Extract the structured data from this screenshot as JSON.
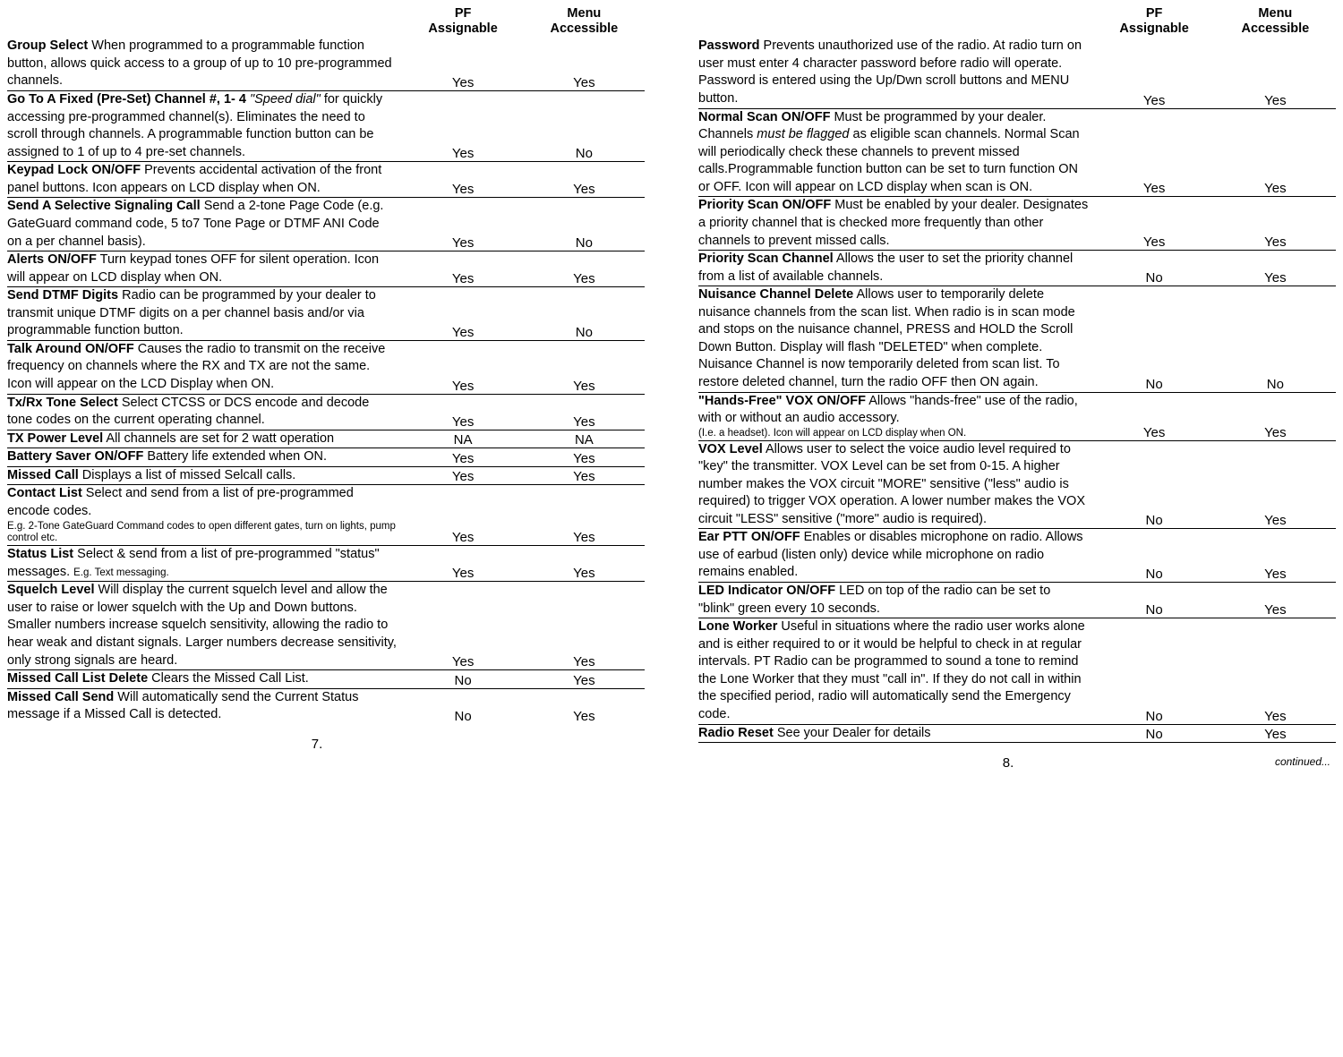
{
  "headers": {
    "pf_line1": "PF",
    "pf_line2": "Assignable",
    "menu_line1": "Menu",
    "menu_line2": "Accessible"
  },
  "pages": [
    {
      "number": "7.",
      "rows": [
        {
          "title": "Group Select",
          "text": " When programmed to a programmable function button, allows quick access to a group of up to 10 pre-programmed channels.",
          "pf": "Yes",
          "menu": "Yes"
        },
        {
          "title": "Go To A Fixed (Pre-Set) Channel #, 1- 4",
          "ital": " \"Speed dial\"",
          "text": " for quickly accessing pre-programmed channel(s). Eliminates the need to scroll through channels. A programmable function button can be assigned to 1 of up to 4 pre-set channels.",
          "pf": "Yes",
          "menu": "No"
        },
        {
          "title": "Keypad Lock ON/OFF",
          "text": " Prevents accidental activation of the front panel buttons. Icon appears on LCD display when ON.",
          "pf": "Yes",
          "menu": "Yes"
        },
        {
          "title": "Send A Selective Signaling Call",
          "text": " Send a 2-tone Page Code (e.g. GateGuard command code, 5 to7 Tone Page or DTMF ANI Code on a per channel basis).",
          "pf": "Yes",
          "menu": "No"
        },
        {
          "title": "Alerts ON/OFF",
          "text": " Turn keypad tones OFF for silent operation. Icon will appear on LCD display when ON.",
          "pf": "Yes",
          "menu": "Yes"
        },
        {
          "title": "Send DTMF Digits",
          "text": " Radio can be programmed by your dealer to transmit unique DTMF digits on a per channel basis and/or via programmable function button.",
          "pf": "Yes",
          "menu": "No"
        },
        {
          "title": "Talk Around ON/OFF",
          "text": " Causes the radio to transmit on the receive frequency on channels where the RX and TX are not the same. Icon will appear on the LCD Display when ON.",
          "pf": "Yes",
          "menu": "Yes"
        },
        {
          "title": "Tx/Rx Tone Select",
          "text": " Select CTCSS or DCS encode and decode tone codes on the current operating channel.",
          "pf": "Yes",
          "menu": "Yes"
        },
        {
          "title": "TX Power Level",
          "text": " All channels are set for 2 watt operation",
          "pf": "NA",
          "menu": "NA"
        },
        {
          "title": "Battery Saver ON/OFF",
          "text": " Battery life extended when ON.",
          "pf": "Yes",
          "menu": "Yes",
          "thick": true
        },
        {
          "title": "Missed Call",
          "text": " Displays a list of missed Selcall calls.",
          "pf": "Yes",
          "menu": "Yes",
          "thick": true
        },
        {
          "title": "Contact List",
          "text": " Select and send from a list of pre-programmed encode codes.",
          "small": "E.g. 2-Tone GateGuard Command codes to open different gates, turn on lights, pump control etc.",
          "pf": "Yes",
          "menu": "Yes"
        },
        {
          "title": "Status List",
          "text": " Select & send from a list of pre-programmed \"status\" messages. ",
          "small_inline": "E.g. Text messaging.",
          "pf": "Yes",
          "menu": "Yes"
        },
        {
          "title": "Squelch Level",
          "text": " Will display the current squelch level and allow the user to raise or lower squelch with the Up and Down buttons. Smaller numbers increase squelch sensitivity, allowing the radio to hear weak and distant signals. Larger numbers decrease sensitivity, only strong signals are heard.",
          "pf": "Yes",
          "menu": "Yes"
        },
        {
          "title": "Missed Call List Delete",
          "text": " Clears the Missed Call List.",
          "pf": "No",
          "menu": "Yes"
        },
        {
          "title": "Missed Call Send",
          "text": " Will automatically send the Current Status message if a Missed Call is detected.",
          "pf": "No",
          "menu": "Yes"
        }
      ]
    },
    {
      "number": "8.",
      "continued": "continued...",
      "rows": [
        {
          "title": "Password",
          "text": " Prevents unauthorized use of the radio. At radio turn on user must enter 4 character password before radio will operate. Password is entered using the Up/Dwn scroll buttons and MENU button.",
          "pf": "Yes",
          "menu": "Yes"
        },
        {
          "title": "Normal Scan ON/OFF",
          "text": " Must be programmed by your dealer. Channels ",
          "ital_mid": "must be flagged",
          "text2": " as eligible scan channels. Normal Scan will periodically check these channels to prevent missed calls.Programmable function button can be set to turn function ON or OFF. Icon will appear on LCD display when scan is ON.",
          "pf": "Yes",
          "menu": "Yes"
        },
        {
          "title": "Priority Scan ON/OFF",
          "text": " Must be enabled by your dealer. Designates a priority channel that is checked more frequently than other channels to prevent missed calls.",
          "pf": "Yes",
          "menu": "Yes"
        },
        {
          "title": "Priority Scan Channel",
          "text": " Allows the user to set the priority channel from a list of available channels.",
          "pf": "No",
          "menu": "Yes"
        },
        {
          "title": "Nuisance Channel Delete",
          "text": " Allows user to temporarily delete nuisance channels from the scan list. When radio is in scan mode and stops on the nuisance channel, PRESS and HOLD the Scroll Down Button. Display will flash \"DELETED\" when complete. Nuisance Channel is now temporarily deleted from scan list. To restore deleted channel, turn the radio OFF then ON again.",
          "pf": "No",
          "menu": "No"
        },
        {
          "title": "\"Hands-Free\" VOX ON/OFF",
          "text": " Allows \"hands-free\" use of the radio, with or without an audio accessory.",
          "small": "(I.e. a headset). Icon will appear on LCD display when ON.",
          "pf": "Yes",
          "menu": "Yes"
        },
        {
          "title": "VOX Level",
          "text": " Allows user to select the voice audio level required to \"key\" the transmitter. VOX Level can be set from 0-15. A higher number makes the VOX circuit \"MORE\" sensitive (\"less\" audio is required) to trigger VOX operation. A lower number makes the VOX circuit \"LESS\" sensitive (\"more\" audio is required).",
          "pf": "No",
          "menu": "Yes",
          "thick": true
        },
        {
          "title": "Ear PTT ON/OFF",
          "text": " Enables or disables microphone on radio. Allows use of earbud (listen only) device while microphone on radio remains enabled.",
          "pf": "No",
          "menu": "Yes"
        },
        {
          "title": "LED Indicator ON/OFF",
          "text": " LED on top of the radio can be set to \"blink\" green every 10 seconds.",
          "pf": "No",
          "menu": "Yes"
        },
        {
          "title": "Lone Worker",
          "text": " Useful in situations where the radio user works alone and is either required to or it would be helpful to check in at regular intervals. PT Radio can be programmed to sound a tone to remind the Lone Worker that they must \"call in\". If they do not call in within the specified period, radio will automatically send the Emergency code.",
          "pf": "No",
          "menu": "Yes"
        },
        {
          "title": "Radio Reset",
          "text": " See your Dealer for details",
          "pf": "No",
          "menu": "Yes",
          "last": true
        }
      ]
    }
  ]
}
